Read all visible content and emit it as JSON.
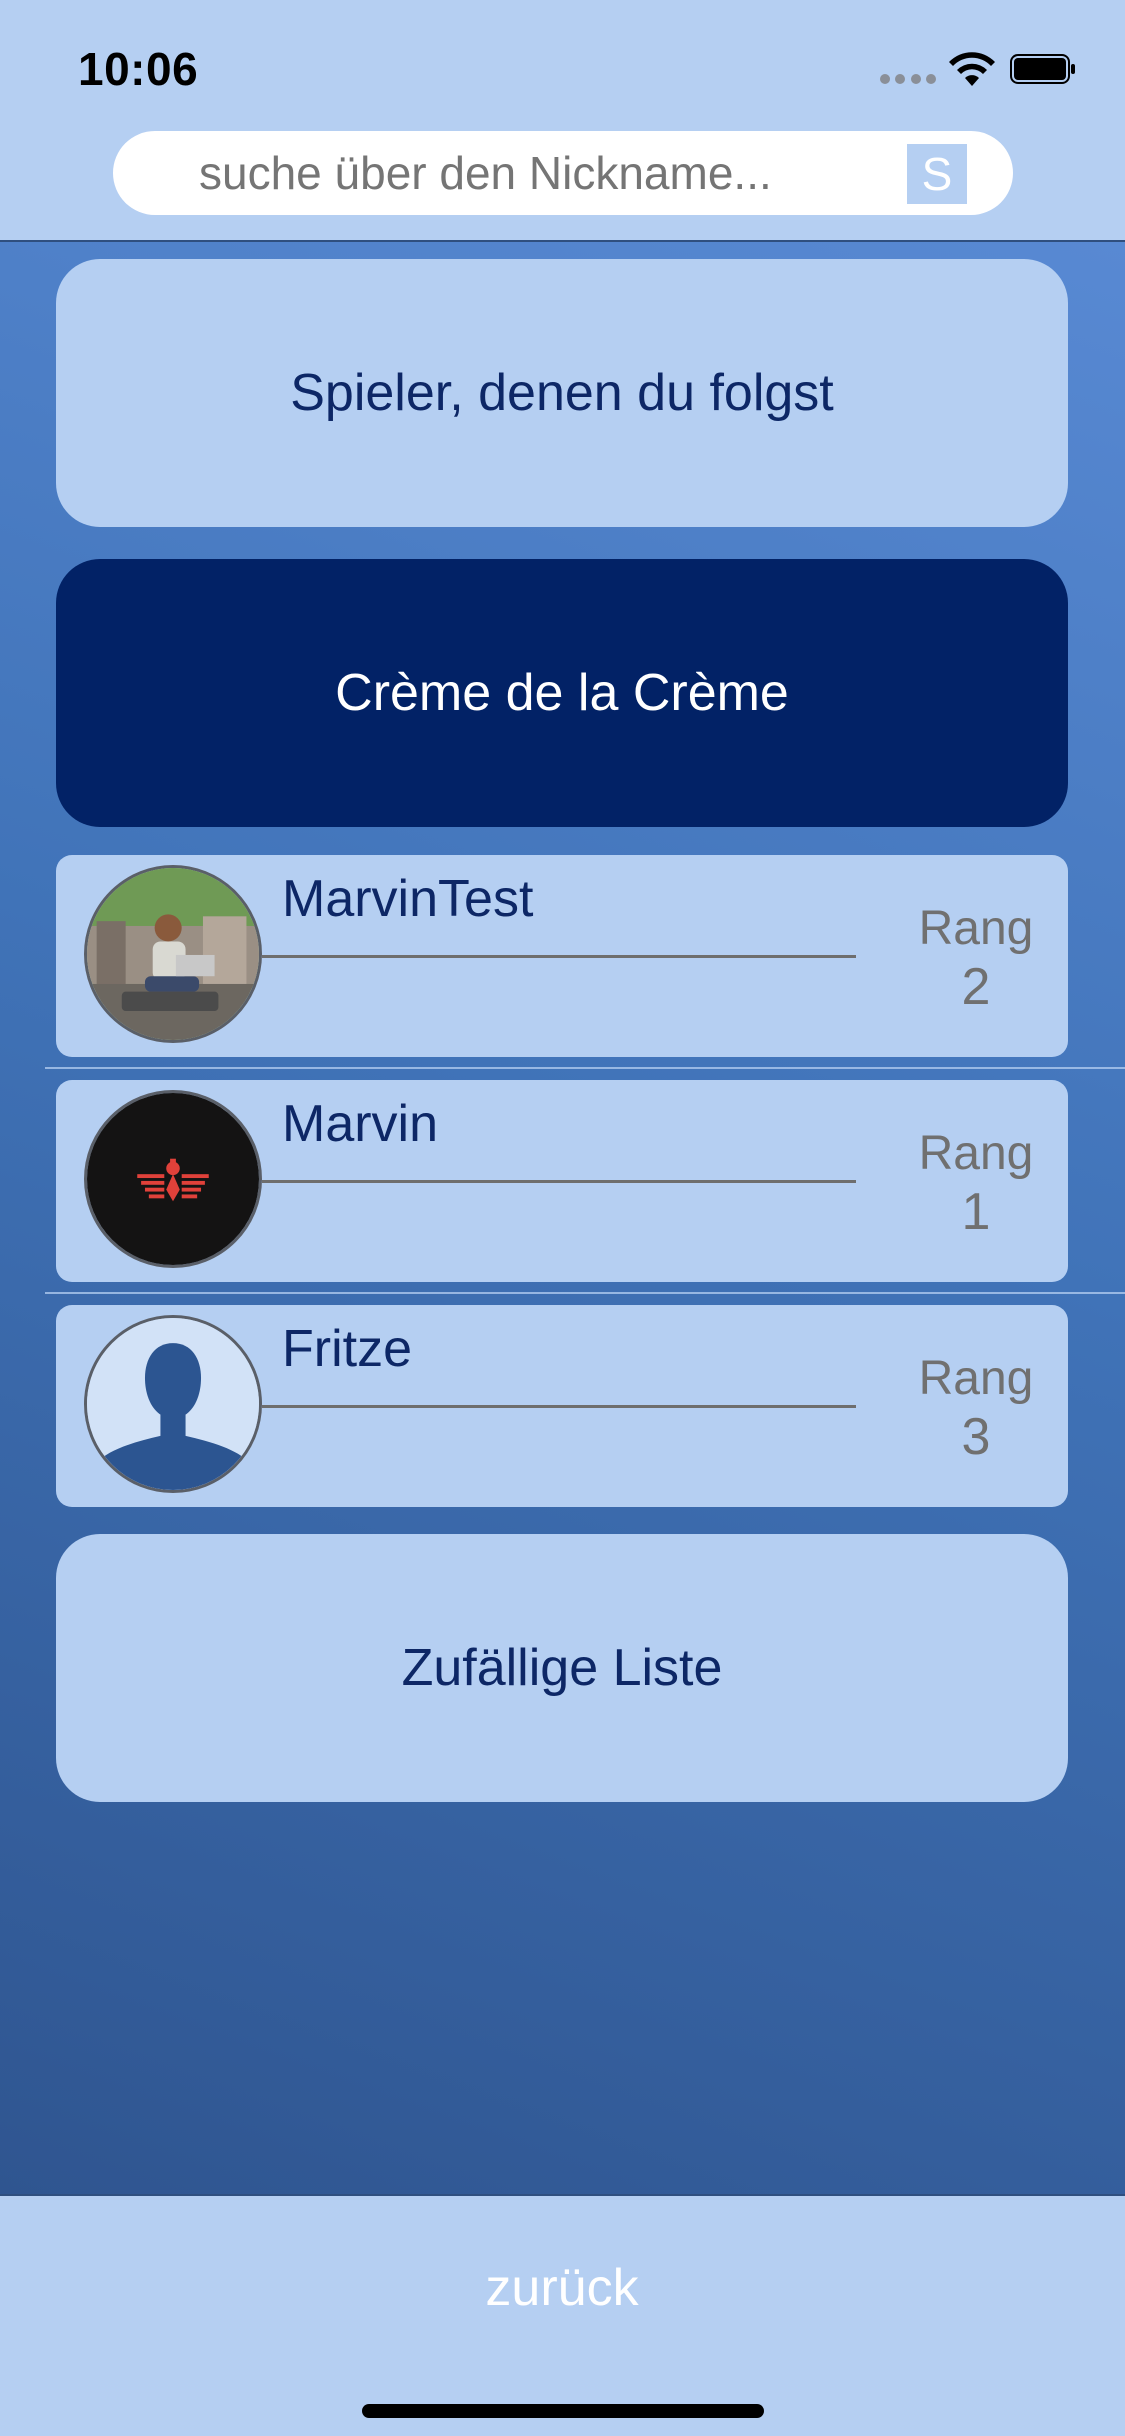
{
  "status_bar": {
    "time": "10:06",
    "icons": [
      "signal-dots-icon",
      "wifi-icon",
      "battery-icon"
    ]
  },
  "search": {
    "placeholder": "suche über den Nickname...",
    "button_label": "S"
  },
  "sections": {
    "followed_label": "Spieler, denen du folgst",
    "top_label": "Crème de la Crème",
    "random_label": "Zufällige Liste"
  },
  "players": [
    {
      "name": "MarvinTest",
      "rank_label": "Rang",
      "rank": "2",
      "avatar": "photo-avatar"
    },
    {
      "name": "Marvin",
      "rank_label": "Rang",
      "rank": "1",
      "avatar": "red-emblem-avatar"
    },
    {
      "name": "Fritze",
      "rank_label": "Rang",
      "rank": "3",
      "avatar": "default-silhouette-avatar"
    }
  ],
  "footer": {
    "back_label": "zurück"
  },
  "colors": {
    "light_blue": "#b5cff2",
    "dark_navy": "#022266",
    "text_navy": "#0d2766",
    "rank_gray": "#707070"
  }
}
